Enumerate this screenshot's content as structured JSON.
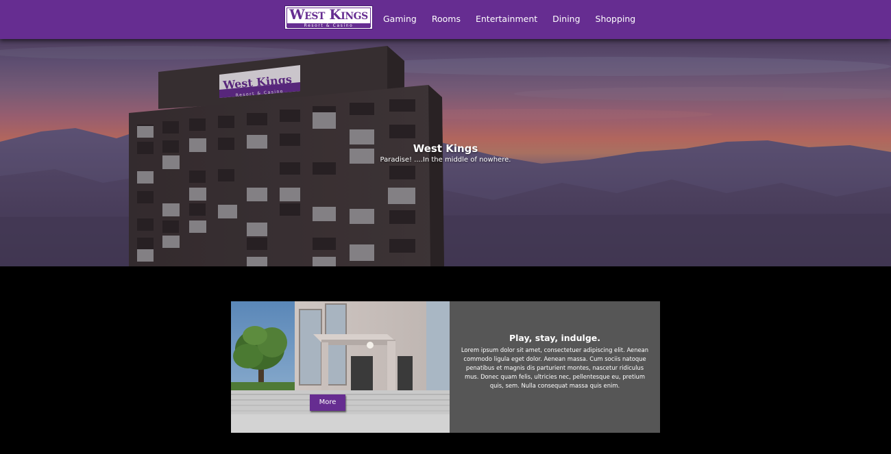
{
  "brand": {
    "logo_name": "West Kings",
    "logo_tagline": "Resort & Casino",
    "primary_color": "#662d91"
  },
  "nav": {
    "items": [
      {
        "label": "Gaming"
      },
      {
        "label": "Rooms"
      },
      {
        "label": "Entertainment"
      },
      {
        "label": "Dining"
      },
      {
        "label": "Shopping"
      }
    ]
  },
  "hero": {
    "title": "West Kings",
    "subtitle": "Paradise! ....In the middle of nowhere.",
    "sign_name": "West Kings",
    "sign_tagline": "Resort & Casino"
  },
  "feature": {
    "title": "Play, stay, indulge.",
    "body": "Lorem ipsum dolor sit amet, consectetuer adipiscing elit. Aenean commodo ligula eget dolor. Aenean massa. Cum sociis natoque penatibus et magnis dis parturient montes, nascetur ridiculus mus. Donec quam felis, ultricies nec, pellentesque eu, pretium quis, sem. Nulla consequat massa quis enim.",
    "button_label": "More"
  }
}
